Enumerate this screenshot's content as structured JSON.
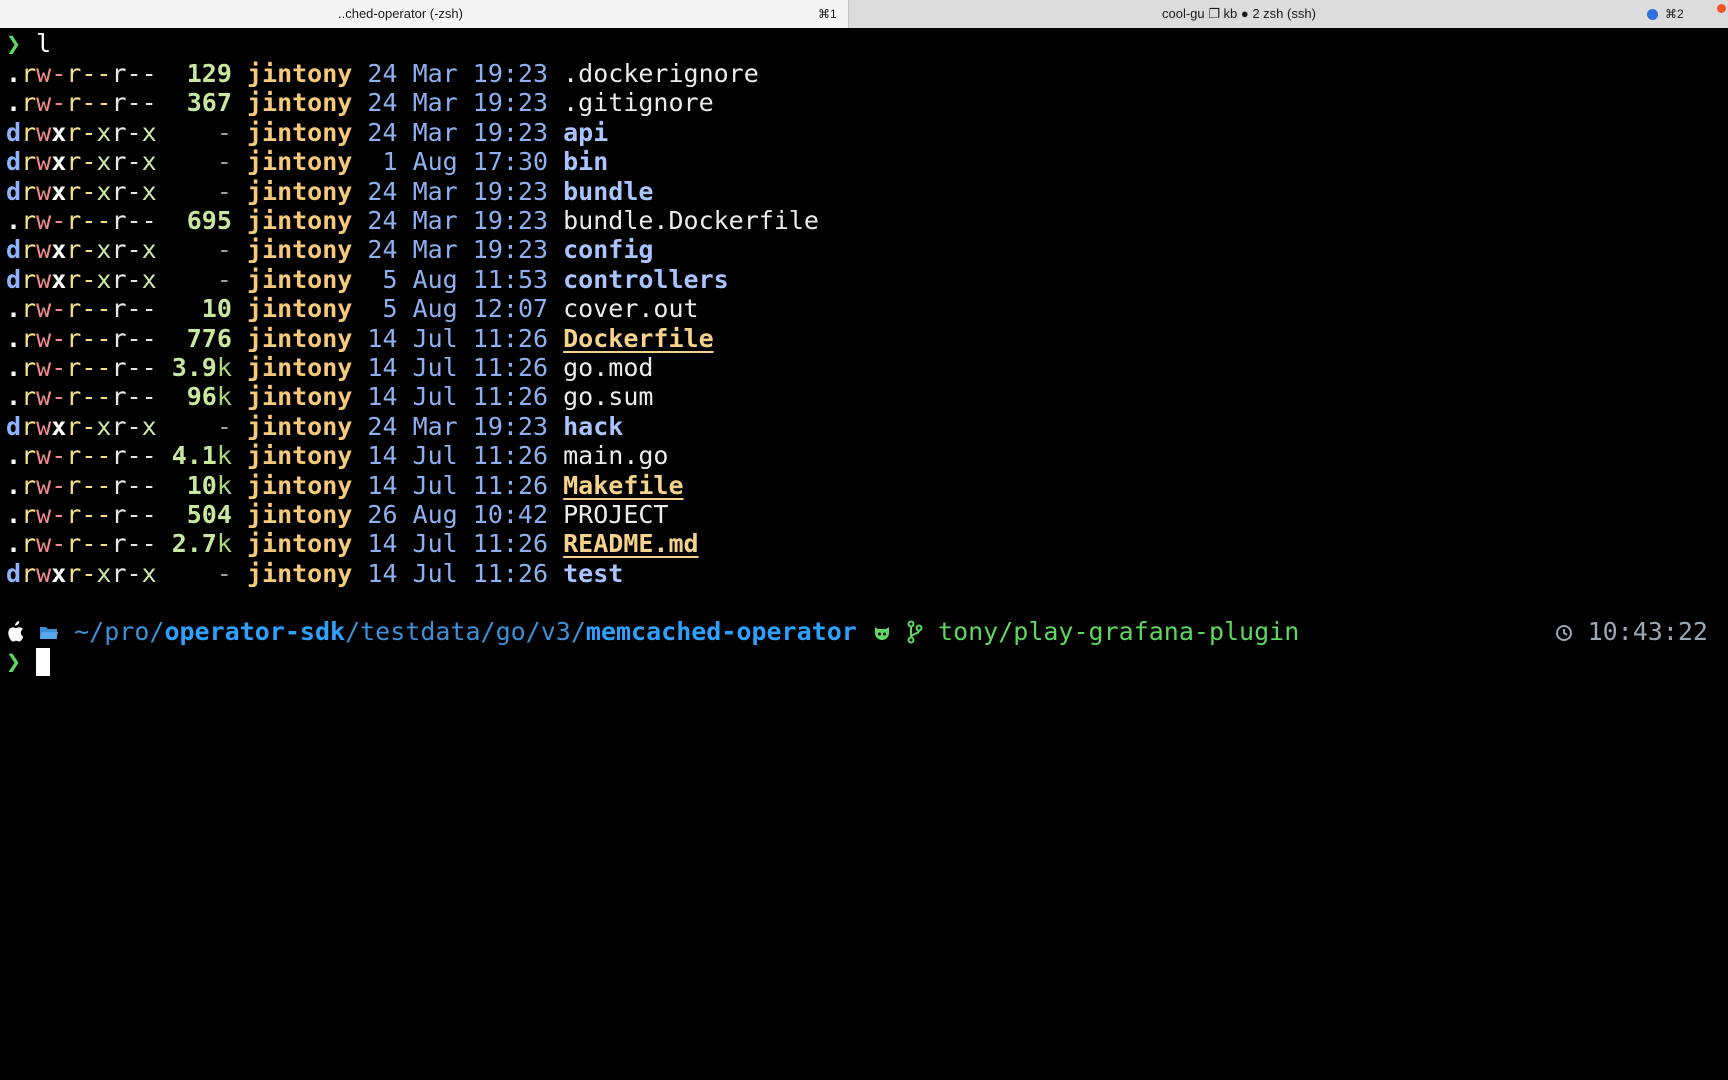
{
  "tabs": [
    {
      "title": "..ched-operator (-zsh)",
      "shortcut": "⌘1"
    },
    {
      "title": "cool-gu ❐ kb ● 2 zsh (ssh)",
      "shortcut": "⌘2"
    }
  ],
  "command": {
    "prompt": "❯",
    "text": "l"
  },
  "listing": [
    {
      "perm": ".rw-r--r--",
      "size": "129",
      "unit": "",
      "user": "jintony",
      "day": "24",
      "month": "Mar",
      "time": "19:23",
      "name": ".dockerignore",
      "kind": "file"
    },
    {
      "perm": ".rw-r--r--",
      "size": "367",
      "unit": "",
      "user": "jintony",
      "day": "24",
      "month": "Mar",
      "time": "19:23",
      "name": ".gitignore",
      "kind": "file"
    },
    {
      "perm": "drwxr-xr-x",
      "size": "-",
      "unit": "",
      "user": "jintony",
      "day": "24",
      "month": "Mar",
      "time": "19:23",
      "name": "api",
      "kind": "dir"
    },
    {
      "perm": "drwxr-xr-x",
      "size": "-",
      "unit": "",
      "user": "jintony",
      "day": "1",
      "month": "Aug",
      "time": "17:30",
      "name": "bin",
      "kind": "dir"
    },
    {
      "perm": "drwxr-xr-x",
      "size": "-",
      "unit": "",
      "user": "jintony",
      "day": "24",
      "month": "Mar",
      "time": "19:23",
      "name": "bundle",
      "kind": "dir"
    },
    {
      "perm": ".rw-r--r--",
      "size": "695",
      "unit": "",
      "user": "jintony",
      "day": "24",
      "month": "Mar",
      "time": "19:23",
      "name": "bundle.Dockerfile",
      "kind": "file"
    },
    {
      "perm": "drwxr-xr-x",
      "size": "-",
      "unit": "",
      "user": "jintony",
      "day": "24",
      "month": "Mar",
      "time": "19:23",
      "name": "config",
      "kind": "dir"
    },
    {
      "perm": "drwxr-xr-x",
      "size": "-",
      "unit": "",
      "user": "jintony",
      "day": "5",
      "month": "Aug",
      "time": "11:53",
      "name": "controllers",
      "kind": "dir"
    },
    {
      "perm": ".rw-r--r--",
      "size": "10",
      "unit": "",
      "user": "jintony",
      "day": "5",
      "month": "Aug",
      "time": "12:07",
      "name": "cover.out",
      "kind": "file"
    },
    {
      "perm": ".rw-r--r--",
      "size": "776",
      "unit": "",
      "user": "jintony",
      "day": "14",
      "month": "Jul",
      "time": "11:26",
      "name": "Dockerfile",
      "kind": "special"
    },
    {
      "perm": ".rw-r--r--",
      "size": "3.9",
      "unit": "k",
      "user": "jintony",
      "day": "14",
      "month": "Jul",
      "time": "11:26",
      "name": "go.mod",
      "kind": "file"
    },
    {
      "perm": ".rw-r--r--",
      "size": "96",
      "unit": "k",
      "user": "jintony",
      "day": "14",
      "month": "Jul",
      "time": "11:26",
      "name": "go.sum",
      "kind": "file"
    },
    {
      "perm": "drwxr-xr-x",
      "size": "-",
      "unit": "",
      "user": "jintony",
      "day": "24",
      "month": "Mar",
      "time": "19:23",
      "name": "hack",
      "kind": "dir"
    },
    {
      "perm": ".rw-r--r--",
      "size": "4.1",
      "unit": "k",
      "user": "jintony",
      "day": "14",
      "month": "Jul",
      "time": "11:26",
      "name": "main.go",
      "kind": "file"
    },
    {
      "perm": ".rw-r--r--",
      "size": "10",
      "unit": "k",
      "user": "jintony",
      "day": "14",
      "month": "Jul",
      "time": "11:26",
      "name": "Makefile",
      "kind": "special"
    },
    {
      "perm": ".rw-r--r--",
      "size": "504",
      "unit": "",
      "user": "jintony",
      "day": "26",
      "month": "Aug",
      "time": "10:42",
      "name": "PROJECT",
      "kind": "file"
    },
    {
      "perm": ".rw-r--r--",
      "size": "2.7",
      "unit": "k",
      "user": "jintony",
      "day": "14",
      "month": "Jul",
      "time": "11:26",
      "name": "README.md",
      "kind": "special"
    },
    {
      "perm": "drwxr-xr-x",
      "size": "-",
      "unit": "",
      "user": "jintony",
      "day": "14",
      "month": "Jul",
      "time": "11:26",
      "name": "test",
      "kind": "dir"
    }
  ],
  "prompt": {
    "path_prefix": "~/pro/",
    "path_bold1": "operator-sdk",
    "path_mid": "/testdata/go/v3/",
    "path_bold2": "memcached-operator",
    "branch": "tony/play-grafana-plugin",
    "clock": "10:43:22",
    "symbol": "❯",
    "icons": [
      "apple-icon",
      "folder-icon",
      "github-icon",
      "git-branch-icon",
      "clock-icon"
    ]
  }
}
